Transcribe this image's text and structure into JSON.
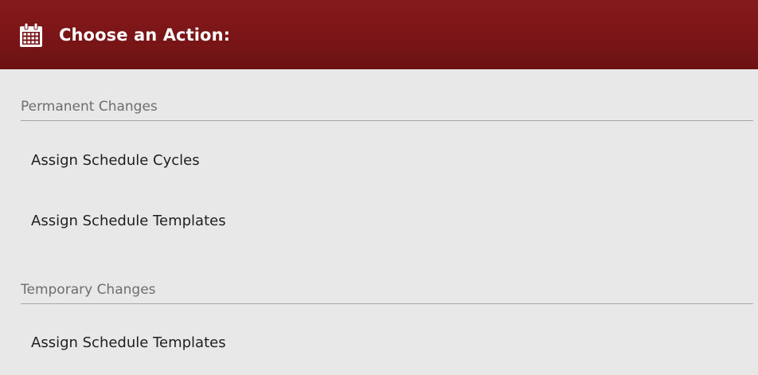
{
  "header": {
    "title": "Choose an Action:",
    "icon": "calendar-icon",
    "background_color": "#7a1517"
  },
  "sections": [
    {
      "title": "Permanent Changes",
      "actions": [
        {
          "label": "Assign Schedule Cycles"
        },
        {
          "label": "Assign Schedule Templates"
        }
      ]
    },
    {
      "title": "Temporary Changes",
      "actions": [
        {
          "label": "Assign Schedule Templates"
        }
      ]
    }
  ]
}
